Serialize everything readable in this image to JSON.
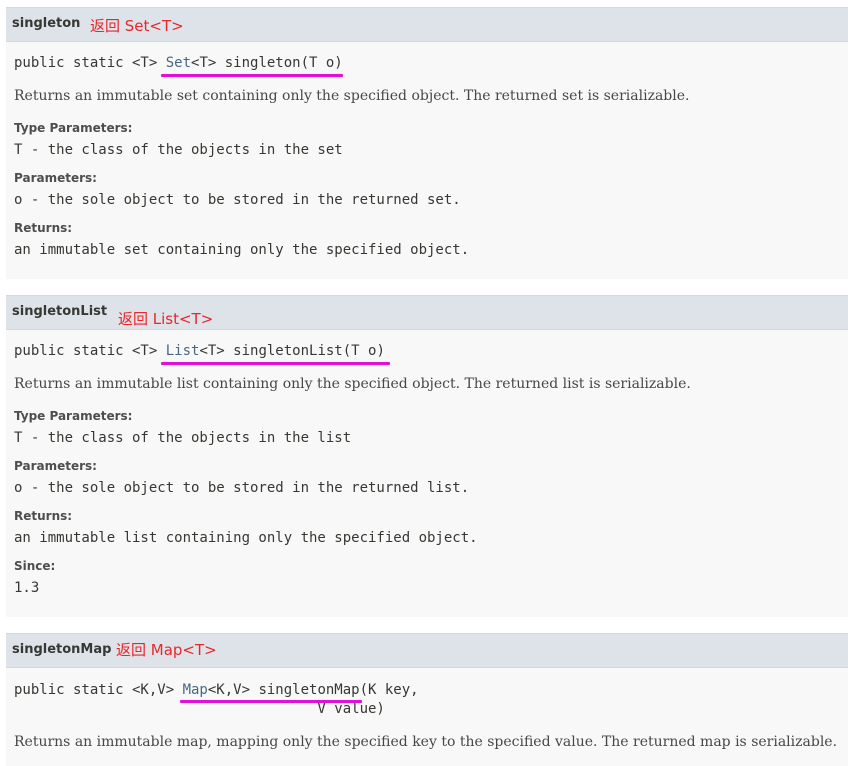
{
  "methods": [
    {
      "name": "singleton",
      "note": "返回 Set<T>",
      "sig_prefix": "public static <T> ",
      "return_type": "Set",
      "sig_rest": "<T> singleton(T o)",
      "description": "Returns an immutable set containing only the specified object. The returned set is serializable.",
      "type_params_label": "Type Parameters:",
      "type_params_value": "T - the class of the objects in the set",
      "params_label": "Parameters:",
      "params_value": "o - the sole object to be stored in the returned set.",
      "returns_label": "Returns:",
      "returns_value": "an immutable set containing only the specified object."
    },
    {
      "name": "singletonList",
      "note": "返回 List<T>",
      "sig_prefix": "public static <T> ",
      "return_type": "List",
      "sig_rest": "<T> singletonList(T o)",
      "description": "Returns an immutable list containing only the specified object. The returned list is serializable.",
      "type_params_label": "Type Parameters:",
      "type_params_value": "T - the class of the objects in the list",
      "params_label": "Parameters:",
      "params_value": "o - the sole object to be stored in the returned list.",
      "returns_label": "Returns:",
      "returns_value": "an immutable list containing only the specified object.",
      "since_label": "Since:",
      "since_value": "1.3"
    },
    {
      "name": "singletonMap",
      "note": "返回 Map<T>",
      "sig_prefix": "public static <K,V> ",
      "return_type": "Map",
      "sig_rest": "<K,V> singletonMap(K key,",
      "sig_line2": "                                    V value)",
      "description": "Returns an immutable map, mapping only the specified key to the specified value. The returned map is serializable."
    }
  ]
}
